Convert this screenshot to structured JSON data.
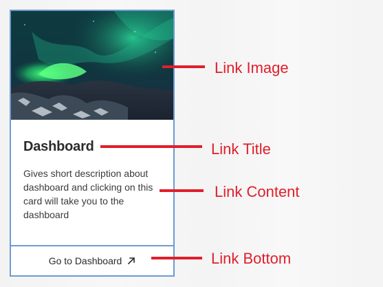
{
  "card": {
    "title": "Dashboard",
    "content": "Gives short description about dashboard and clicking on this card will take you to the dashboard",
    "bottom_label": "Go to Dashboard",
    "bottom_icon": "arrow-up-right-icon",
    "image_subject": "aurora-borealis-photo"
  },
  "annotations": [
    {
      "label": "Link Image"
    },
    {
      "label": "Link Title"
    },
    {
      "label": "Link Content"
    },
    {
      "label": "Link Bottom"
    }
  ],
  "colors": {
    "card_border": "#6d9ad0",
    "annotation": "#e01e2a",
    "text": "#2b2b2b"
  }
}
